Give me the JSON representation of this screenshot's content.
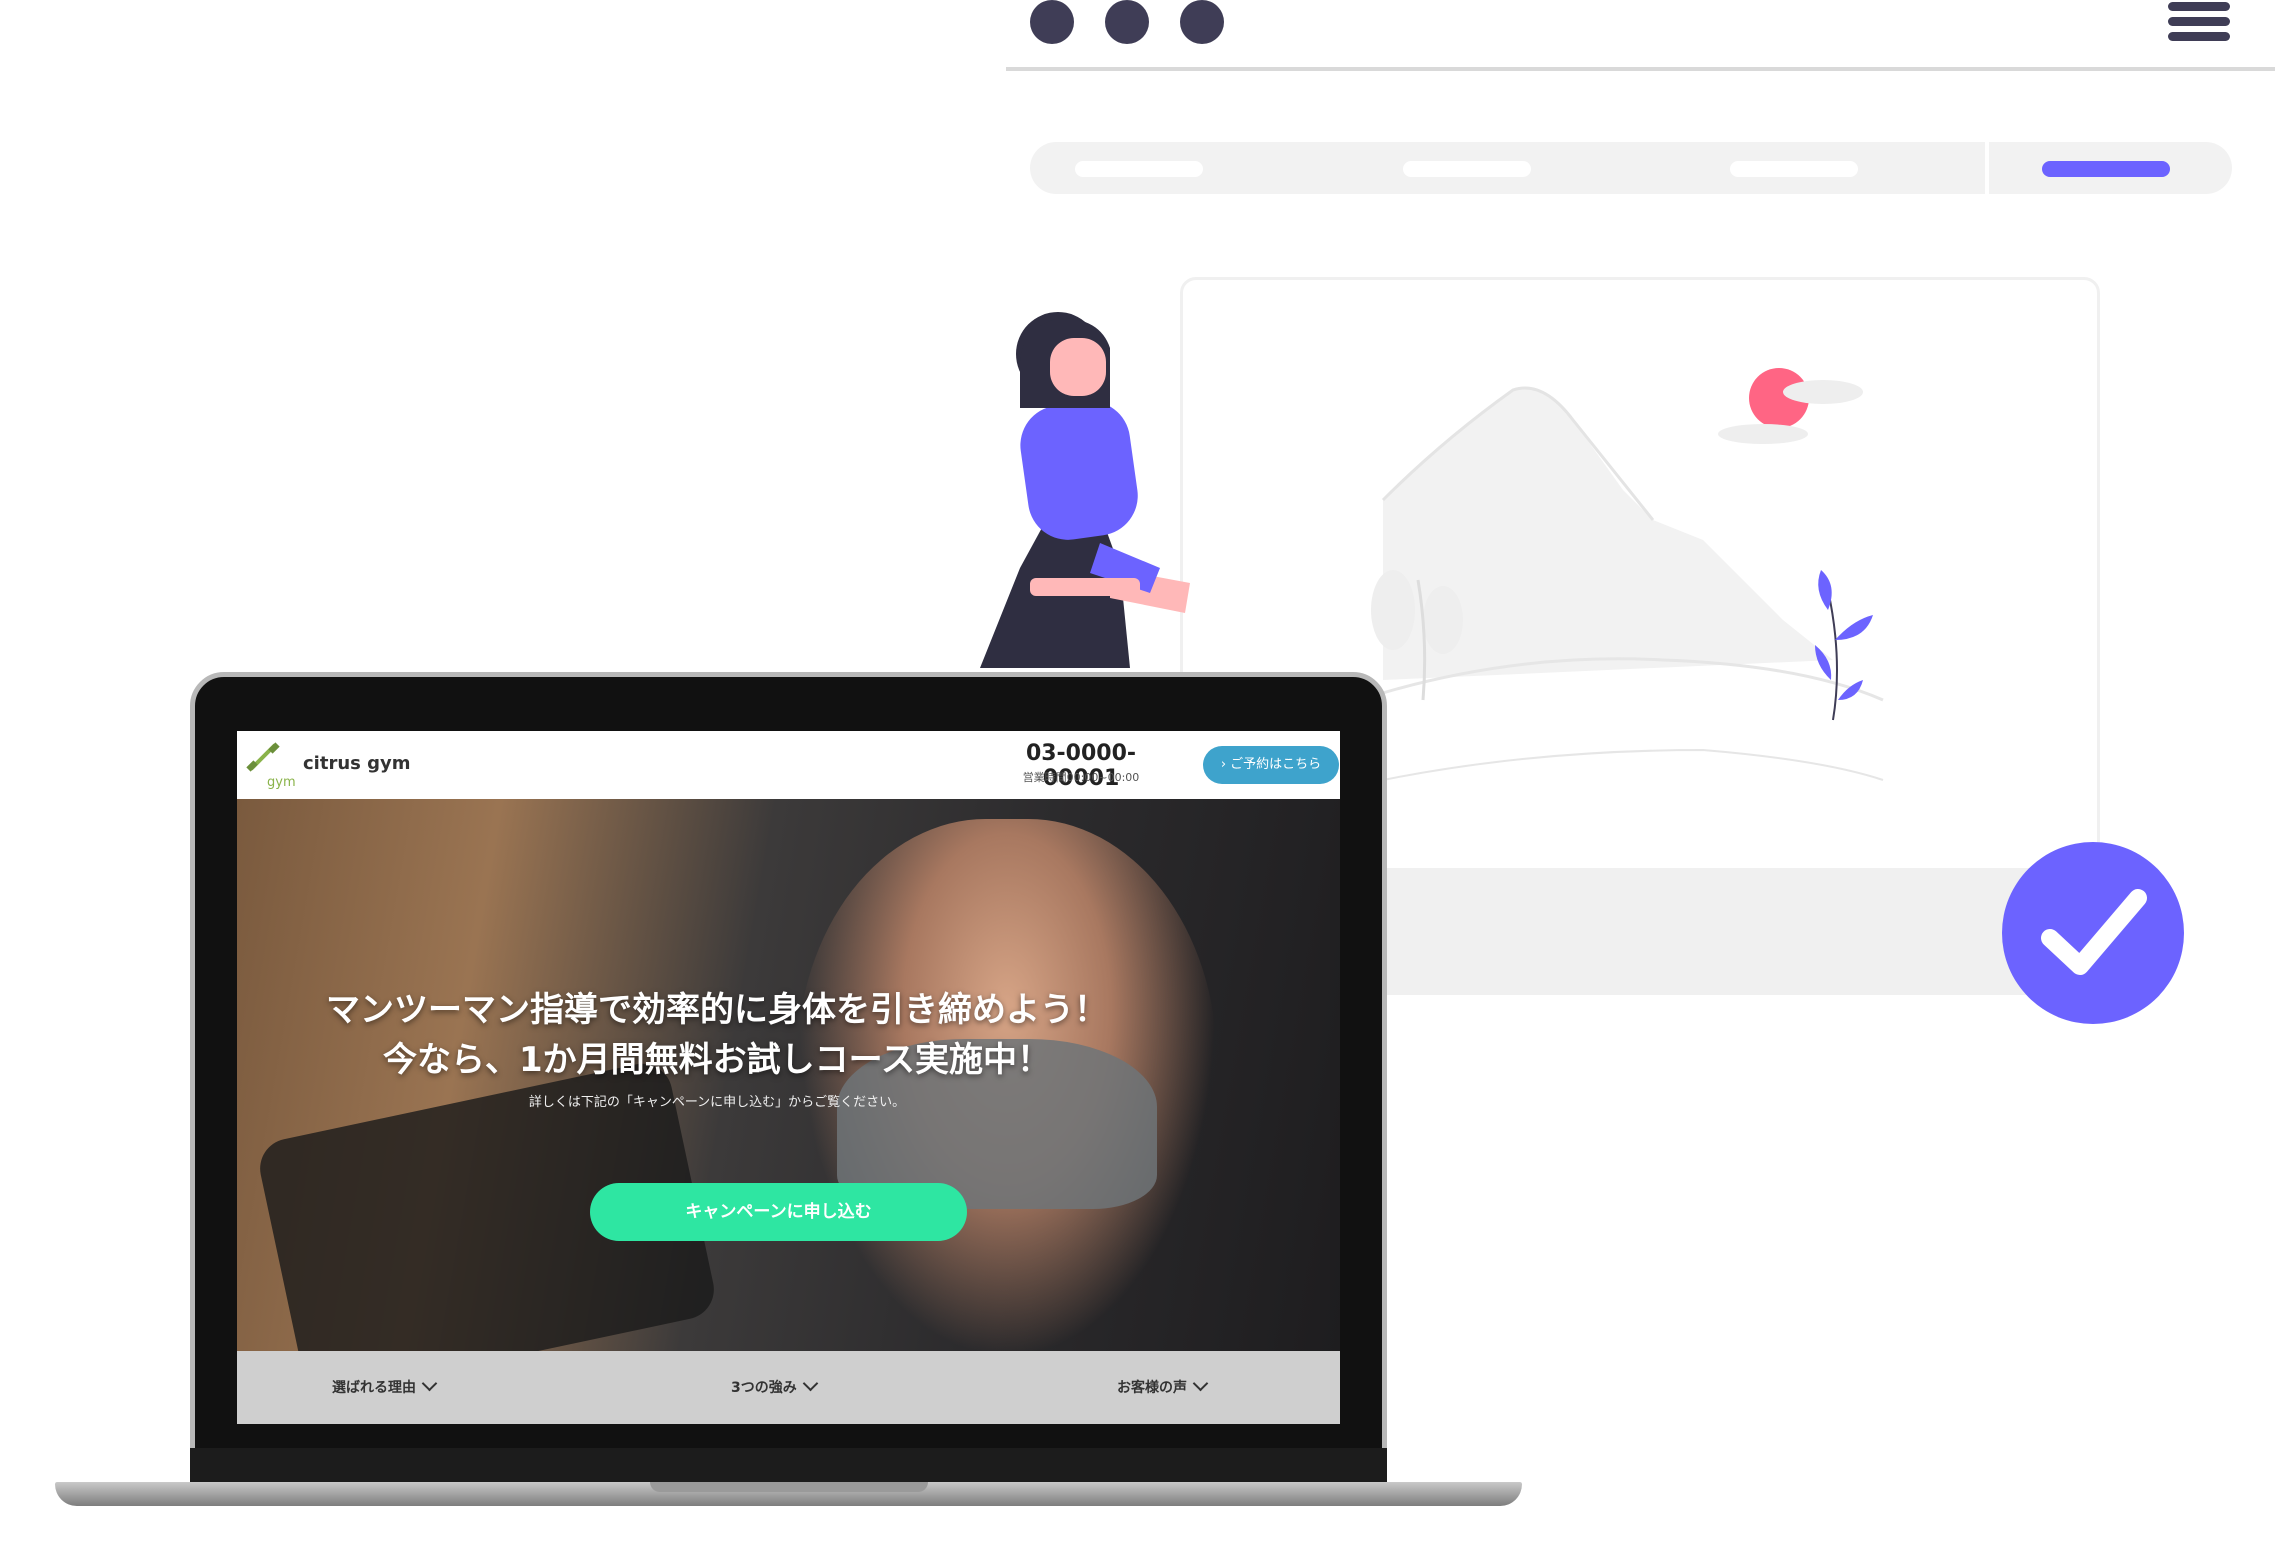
{
  "browser": {
    "menu_icon": "hamburger-icon",
    "window_controls": [
      "dot",
      "dot",
      "dot"
    ],
    "nav_tabs": 4,
    "active_tab_index": 3
  },
  "illustration": {
    "status_icon": "checkmark-icon",
    "colors": {
      "accent": "#6c63ff",
      "sun": "#ff6584",
      "ink": "#3f3d56"
    }
  },
  "site": {
    "brand": "citrus gym",
    "logo_sub": "gym",
    "phone": "03-0000-00001",
    "hours": "営業時間00:00~00:00",
    "reserve_button": "› ご予約はこちら",
    "hero": {
      "title_line1": "マンツーマン指導で効率的に身体を引き締めよう！",
      "title_line2": "今なら、1か月間無料お試しコース実施中！",
      "subtitle": "詳しくは下記の「キャンペーンに申し込む」からご覧ください。",
      "cta": "キャンペーンに申し込む"
    },
    "subnav": [
      "選ばれる理由",
      "3つの強み",
      "お客様の声"
    ],
    "colors": {
      "cta": "#2ee6a2",
      "reserve": "#3ea3cc"
    }
  }
}
